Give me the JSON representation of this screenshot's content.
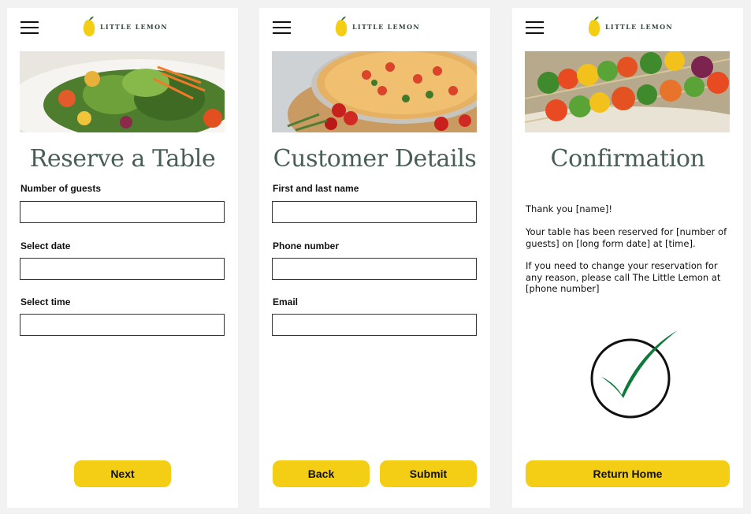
{
  "brand": {
    "name": "LITTLE LEMON"
  },
  "colors": {
    "accent": "#f4ce14",
    "heading": "#495e57",
    "check": "#0e7a3a"
  },
  "screens": {
    "reserve": {
      "title": "Reserve a Table",
      "hero_image": "salad-image",
      "fields": [
        {
          "label": "Number of guests",
          "value": "",
          "placeholder": ""
        },
        {
          "label": "Select date",
          "value": "",
          "placeholder": ""
        },
        {
          "label": "Select time",
          "value": "",
          "placeholder": ""
        }
      ],
      "next_label": "Next"
    },
    "details": {
      "title": "Customer Details",
      "hero_image": "pizza-image",
      "fields": [
        {
          "label": "First and last name",
          "value": "",
          "placeholder": ""
        },
        {
          "label": "Phone number",
          "value": "",
          "placeholder": ""
        },
        {
          "label": "Email",
          "value": "",
          "placeholder": ""
        }
      ],
      "back_label": "Back",
      "submit_label": "Submit"
    },
    "confirmation": {
      "title": "Confirmation",
      "hero_image": "skewers-image",
      "greeting": "Thank you [name]!",
      "reserved_text": "Your table has been reserved for [number of guests] on [long form date] at [time].",
      "change_text": "If you need to change your reservation for any reason, please call The Little Lemon at [phone number]",
      "check_icon": "checkmark-icon",
      "return_label": "Return Home"
    }
  }
}
